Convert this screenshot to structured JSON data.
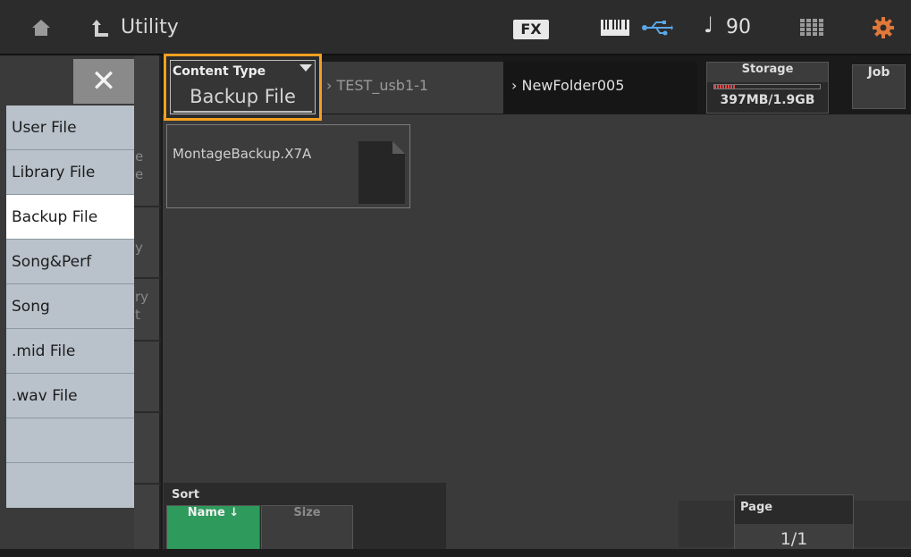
{
  "header": {
    "title": "Utility",
    "fx_label": "FX",
    "tempo": "90",
    "icons": [
      "home-icon",
      "up-level-icon",
      "keyboard-icon",
      "usb-icon",
      "note-icon",
      "grid-icon",
      "gear-icon"
    ]
  },
  "content_type": {
    "label": "Content Type",
    "value": "Backup File"
  },
  "dropdown": {
    "items": [
      "User File",
      "Library File",
      "Backup File",
      "Song&Perf",
      "Song",
      ".mid File",
      ".wav File",
      "",
      ""
    ],
    "selected": "Backup File"
  },
  "sidebar_fragments": [
    "e",
    "e",
    "y",
    "ry",
    "t"
  ],
  "path": {
    "parent": "TEST_usb1-1",
    "current": "NewFolder005"
  },
  "storage": {
    "label": "Storage",
    "value": "397MB/1.9GB",
    "used_fraction": 0.2
  },
  "job_label": "Job",
  "files": [
    {
      "name": "MontageBackup.X7A"
    }
  ],
  "sort": {
    "label": "Sort",
    "name_label": "Name ↓",
    "size_label": "Size"
  },
  "page": {
    "label": "Page",
    "value": "1/1"
  },
  "colors": {
    "accent": "#f5a020",
    "sort_active": "#2e9a5c",
    "dropdown_bg": "#b9c2cb",
    "storage_fill": "#d84a4a"
  }
}
